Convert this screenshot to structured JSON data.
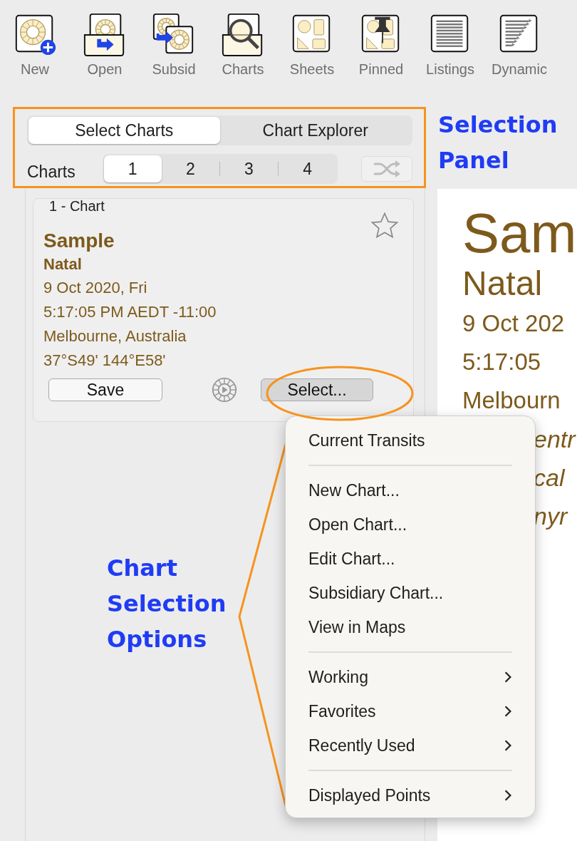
{
  "toolbar": {
    "items": [
      {
        "label": "New",
        "kind": "new"
      },
      {
        "label": "Open",
        "kind": "open"
      },
      {
        "label": "Subsid",
        "kind": "subsid"
      },
      {
        "label": "Charts",
        "kind": "charts"
      },
      {
        "label": "Sheets",
        "kind": "sheets"
      },
      {
        "label": "Pinned",
        "kind": "pinned"
      },
      {
        "label": "Listings",
        "kind": "listings"
      },
      {
        "label": "Dynamic",
        "kind": "dynamic"
      }
    ]
  },
  "selection_panel": {
    "tabs": [
      {
        "label": "Select Charts",
        "selected": true
      },
      {
        "label": "Chart Explorer",
        "selected": false
      }
    ],
    "charts_label": "Charts",
    "chart_slots": [
      {
        "label": "1",
        "selected": true
      },
      {
        "label": "2",
        "selected": false
      },
      {
        "label": "3",
        "selected": false
      },
      {
        "label": "4",
        "selected": false
      }
    ],
    "shuffle_disabled": true
  },
  "chart_card": {
    "header": "1 - Chart",
    "favorite": false,
    "name": "Sample",
    "chart_type": "Natal",
    "details": [
      "9 Oct 2020, Fri",
      "5:17:05 PM AEDT -11:00",
      "Melbourne, Australia",
      "37°S49' 144°E58'"
    ],
    "save_button": "Save",
    "select_button": "Select..."
  },
  "chart_view": {
    "lines": [
      {
        "text": "Sam",
        "kind": "title"
      },
      {
        "text": "Natal",
        "kind": "subtitle"
      },
      {
        "text": "9 Oct 202",
        "kind": "detail"
      },
      {
        "text": "5:17:05",
        "kind": "detail"
      },
      {
        "text": "Melbourn",
        "kind": "detail"
      },
      {
        "text": "entr",
        "kind": "behind"
      },
      {
        "text": "cal",
        "kind": "behind"
      },
      {
        "text": "nyr",
        "kind": "behind"
      }
    ]
  },
  "menu": {
    "sections": [
      [
        {
          "label": "Current Transits",
          "has_submenu": false
        }
      ],
      [
        {
          "label": "New Chart...",
          "has_submenu": false
        },
        {
          "label": "Open Chart...",
          "has_submenu": false
        },
        {
          "label": "Edit Chart...",
          "has_submenu": false
        },
        {
          "label": "Subsidiary Chart...",
          "has_submenu": false
        },
        {
          "label": "View in Maps",
          "has_submenu": false
        }
      ],
      [
        {
          "label": "Working",
          "has_submenu": true
        },
        {
          "label": "Favorites",
          "has_submenu": true
        },
        {
          "label": "Recently Used",
          "has_submenu": true
        }
      ],
      [
        {
          "label": "Displayed Points",
          "has_submenu": true
        }
      ]
    ]
  },
  "annotations": [
    {
      "text": "Selection Panel",
      "kind": "panel"
    },
    {
      "text": "Chart Selection Options",
      "kind": "menu"
    }
  ]
}
